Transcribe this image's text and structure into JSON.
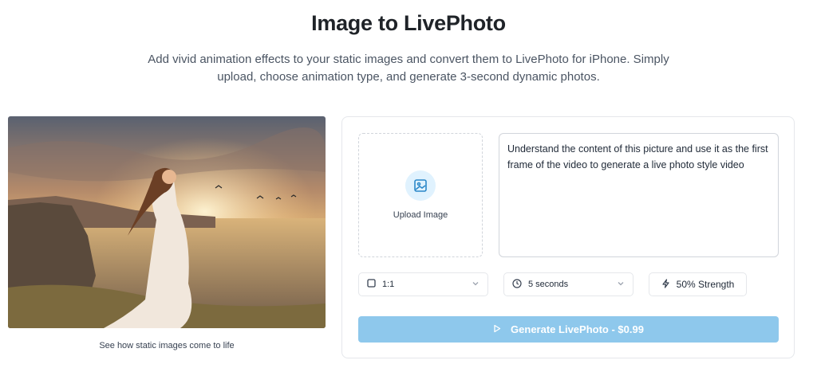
{
  "header": {
    "title": "Image to LivePhoto",
    "subtitle": "Add vivid animation effects to your static images and convert them to LivePhoto for iPhone. Simply upload, choose animation type, and generate 3-second dynamic photos."
  },
  "preview": {
    "caption": "See how static images come to life"
  },
  "panel": {
    "upload": {
      "label": "Upload Image",
      "icon": "image-icon"
    },
    "prompt": {
      "value": "Understand the content of this picture and use it as the first frame of the video to generate a live photo style video"
    },
    "aspect_ratio": {
      "value": "1:1",
      "icon": "square-icon"
    },
    "duration": {
      "value": "5 seconds",
      "icon": "clock-icon"
    },
    "strength": {
      "value": "50% Strength",
      "icon": "lightning-icon"
    },
    "generate": {
      "label": "Generate LivePhoto - $0.99",
      "icon": "play-icon"
    }
  },
  "colors": {
    "accent": "#8ec8ec",
    "icon_bg": "#e0f2fe",
    "icon_fg": "#2b88c8"
  }
}
